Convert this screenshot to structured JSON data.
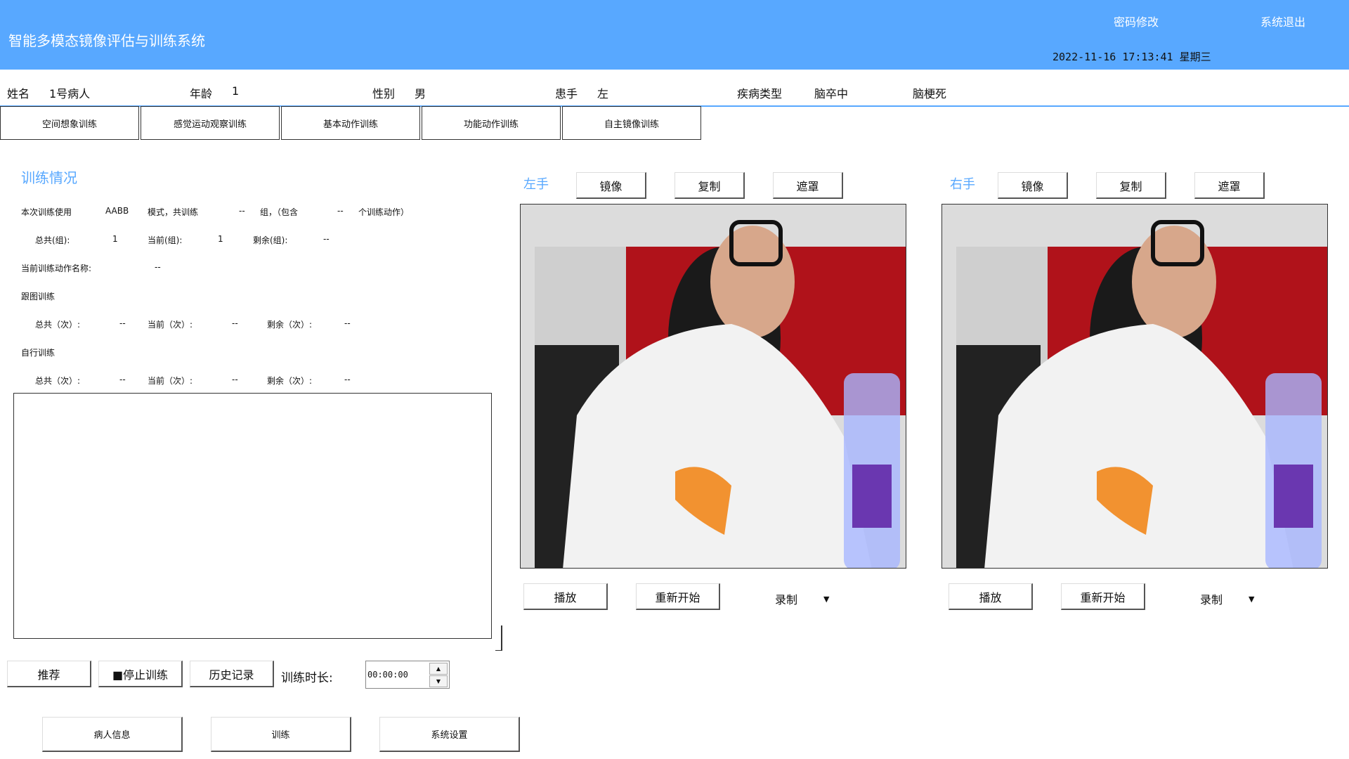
{
  "header": {
    "title": "智能多模态镜像评估与训练系统",
    "change_password": "密码修改",
    "exit": "系统退出",
    "datetime": "2022-11-16  17:13:41  星期三"
  },
  "patient": {
    "name_label": "姓名",
    "name": "1号病人",
    "age_label": "年龄",
    "age": "1",
    "gender_label": "性别",
    "gender": "男",
    "hand_label": "患手",
    "hand": "左",
    "disease_label": "疾病类型",
    "disease": "脑卒中",
    "disease_sub": "脑梗死"
  },
  "tabs": [
    "空间想象训练",
    "感觉运动观察训练",
    "基本动作训练",
    "功能动作训练",
    "自主镜像训练"
  ],
  "training": {
    "title": "训练情况",
    "line1": {
      "a": "本次训练使用",
      "mode": "AABB",
      "b": "模式，共训练",
      "groups": "--",
      "c": "组，（包含",
      "actions": "--",
      "d": "个训练动作）"
    },
    "groups_row": {
      "total_label": "总共(组):",
      "total": "1",
      "current_label": "当前(组):",
      "current": "1",
      "remain_label": "剩余(组):",
      "remain": "--"
    },
    "action_name_label": "当前训练动作名称:",
    "action_name": "--",
    "follow_title": "跟图训练",
    "follow_row": {
      "total_label": "总共（次）:",
      "total": "--",
      "current_label": "当前（次）:",
      "current": "--",
      "remain_label": "剩余（次）:",
      "remain": "--"
    },
    "self_title": "自行训练",
    "self_row": {
      "total_label": "总共（次）:",
      "total": "--",
      "current_label": "当前（次）:",
      "current": "--",
      "remain_label": "剩余（次）:",
      "remain": "--"
    }
  },
  "controls": {
    "recommend": "推荐",
    "stop": "■停止训练",
    "history": "历史记录",
    "duration_label": "训练时长:",
    "duration_value": "00:00:00",
    "spin_up": "▲",
    "spin_down": "▼"
  },
  "bottom_nav": [
    "病人信息",
    "训练",
    "系统设置"
  ],
  "left_hand": {
    "label": "左手",
    "mirror": "镜像",
    "copy": "复制",
    "mask": "遮罩",
    "play": "播放",
    "restart": "重新开始",
    "record": "录制",
    "caret": "▼"
  },
  "right_hand": {
    "label": "右手",
    "mirror": "镜像",
    "copy": "复制",
    "mask": "遮罩",
    "play": "播放",
    "restart": "重新开始",
    "record": "录制",
    "caret": "▼"
  },
  "colors": {
    "header": "#58a8ff",
    "accent": "#58a8ff"
  }
}
